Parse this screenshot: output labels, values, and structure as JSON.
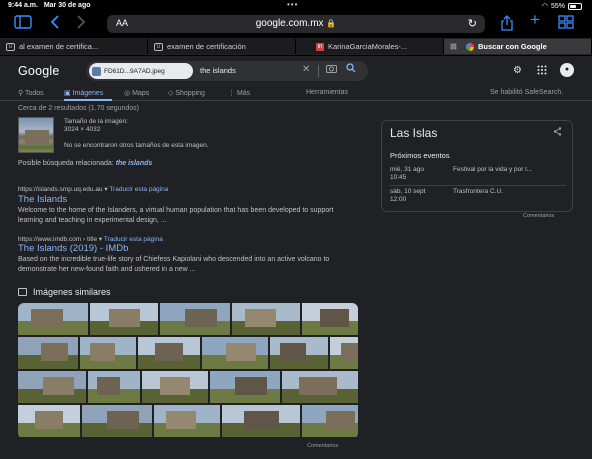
{
  "status": {
    "time": "9:44 a.m.",
    "date": "Mar 30 de ago",
    "battery": "55%",
    "battery_level": 0.55
  },
  "browser": {
    "text_size": "AA",
    "url": "google.com.mx"
  },
  "tabs": [
    {
      "label": "al examen de certifica...",
      "icon": "tab-icon"
    },
    {
      "label": "examen de certificación",
      "icon": "tab-icon"
    },
    {
      "label": "KarinaGarciaMorales-...",
      "icon": "in-icon"
    },
    {
      "label": "Buscar con Google",
      "icon": "google-icon"
    }
  ],
  "google": {
    "logo": "Google",
    "chip_label": "FD61D...9A7AD.jpeg",
    "query": "the islands"
  },
  "nav": {
    "todos": "Todos",
    "imagenes": "Imágenes",
    "maps": "Maps",
    "shopping": "Shopping",
    "mas": "Más",
    "herramientas": "Herramientas",
    "safesearch": "Se habilitó SafeSearch."
  },
  "results": {
    "count": "Cerca de 2 resultados (1.70 segundos)",
    "image_size_label": "Tamaño de la imagen:",
    "image_size": "3024 × 4032",
    "no_other_sizes": "No se encontraron otros tamaños de esta imagen.",
    "related_label": "Posible búsqueda relacionada:",
    "related_query": "the islands",
    "items": [
      {
        "url": "https://islands.smp.uq.edu.au",
        "translate": "Traducir esta página",
        "title": "The Islands",
        "snippet": "Welcome to the home of the Islanders, a virtual human population that has been developed to support learning and teaching in experimental design, ..."
      },
      {
        "url": "https://www.imdb.com › title",
        "translate": "Traducir esta página",
        "title": "The Islands (2019) - IMDb",
        "snippet": "Based on the incredible true-life story of Chiefess Kapiolani who descended into an active volcano to demonstrate her new-found faith and ushered in a new ..."
      }
    ]
  },
  "knowledge_panel": {
    "title": "Las Islas",
    "events_label": "Próximos eventos",
    "events": [
      {
        "date": "mié, 31 ago",
        "time": "10:45",
        "name": "Festival por la vida y por l..."
      },
      {
        "date": "sáb, 10 sept",
        "time": "12:00",
        "name": "Trasfrontera C.U."
      }
    ],
    "comments": "Comentarios"
  },
  "similar": {
    "heading": "Imágenes similares",
    "comments": "Comentarios"
  }
}
